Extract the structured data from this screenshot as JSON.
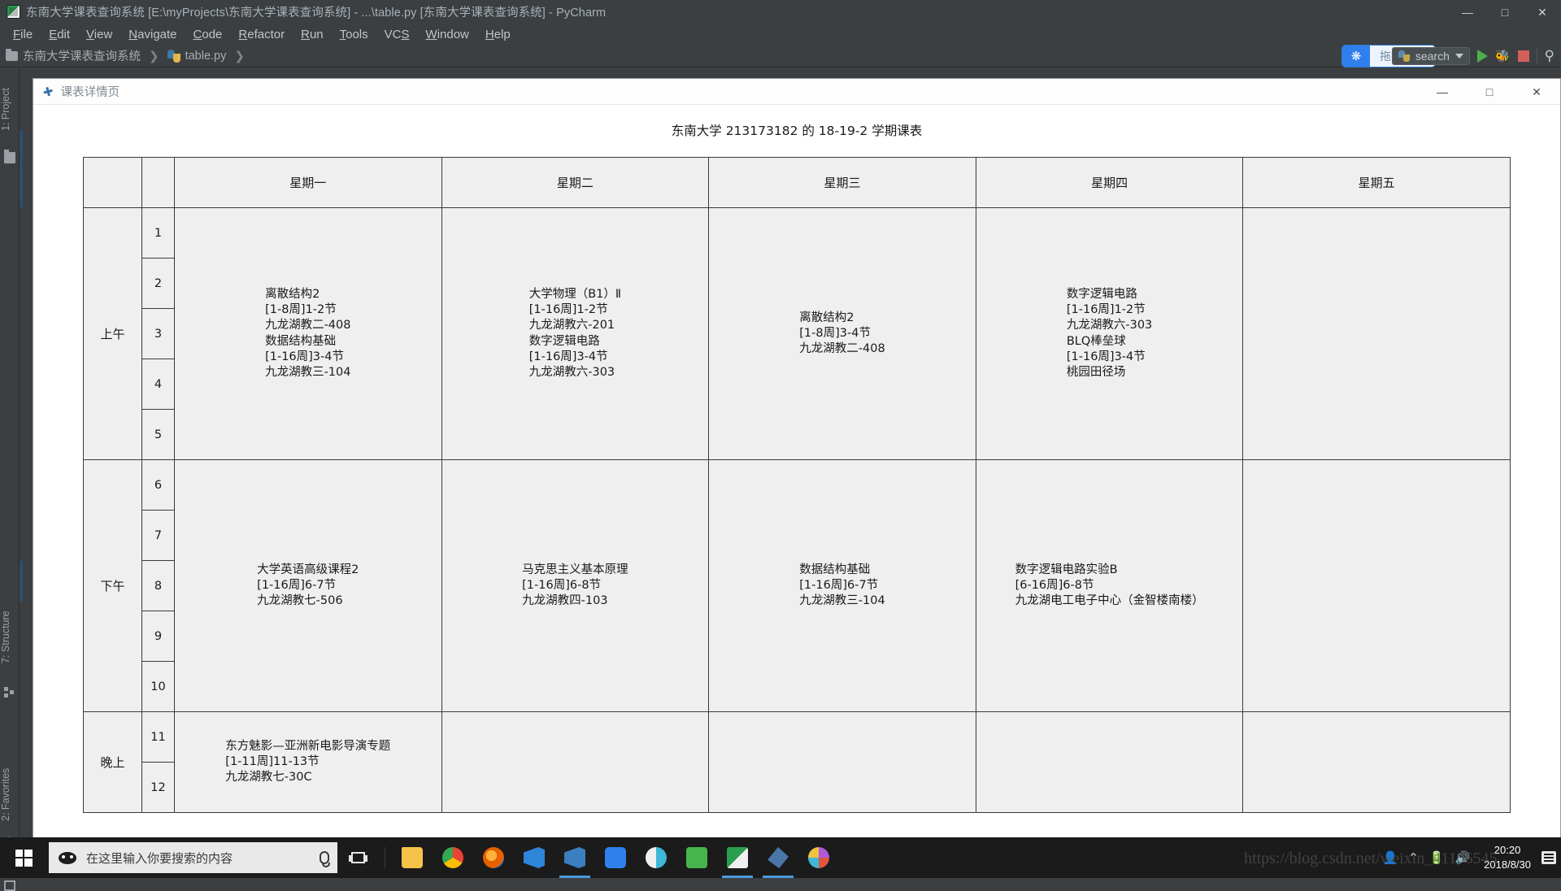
{
  "ide": {
    "window_title": "东南大学课表查询系统 [E:\\myProjects\\东南大学课表查询系统] - ...\\table.py [东南大学课表查询系统] - PyCharm",
    "app_icon": "pycharm-icon",
    "window_controls": {
      "minimize": "—",
      "maximize": "□",
      "close": "✕"
    },
    "menu": [
      {
        "label": "File"
      },
      {
        "label": "Edit"
      },
      {
        "label": "View"
      },
      {
        "label": "Navigate"
      },
      {
        "label": "Code"
      },
      {
        "label": "Refactor"
      },
      {
        "label": "Run"
      },
      {
        "label": "Tools"
      },
      {
        "label": "VCS"
      },
      {
        "label": "Window"
      },
      {
        "label": "Help"
      }
    ],
    "breadcrumb": {
      "project": "东南大学课表查询系统",
      "file": "table.py",
      "separator": "❯"
    },
    "upload_widget": {
      "label": "拖拽上传",
      "icon": "baidu-cloud-icon",
      "accent": "#2f80ed"
    },
    "run_config": {
      "label": "search",
      "icon": "python-file-icon",
      "caret": "▼"
    },
    "toolbar_buttons": [
      {
        "name": "run-button",
        "icon": "play-icon"
      },
      {
        "name": "debug-button",
        "icon": "bug-icon"
      },
      {
        "name": "stop-button",
        "icon": "stop-icon"
      },
      {
        "name": "search-everywhere-button",
        "icon": "search-icon",
        "glyph": "🔍"
      }
    ],
    "tool_strip": [
      {
        "label": "1: Project",
        "icon": "folder-icon"
      },
      {
        "label": "7: Structure",
        "icon": "structure-icon"
      },
      {
        "label": "2: Favorites",
        "icon": "star-icon"
      }
    ]
  },
  "child_window": {
    "title": "课表详情页",
    "icon": "feather-icon",
    "controls": {
      "minimize": "—",
      "maximize": "□",
      "close": "✕"
    }
  },
  "sheet": {
    "title": "东南大学 213173182 的 18-19-2 学期课表",
    "days": [
      "",
      "",
      "星期一",
      "星期二",
      "星期三",
      "星期四",
      "星期五"
    ],
    "segments": [
      {
        "label": "上午",
        "periods": [
          "1",
          "2",
          "3",
          "4",
          "5"
        ]
      },
      {
        "label": "下午",
        "periods": [
          "6",
          "7",
          "8",
          "9",
          "10"
        ]
      },
      {
        "label": "晚上",
        "periods": [
          "11",
          "12"
        ]
      }
    ],
    "cells": {
      "morning": {
        "mon": [
          "离散结构2",
          "[1-8周]1-2节",
          "九龙湖教二-408",
          "数据结构基础",
          "[1-16周]3-4节",
          "九龙湖教三-104"
        ],
        "tue": [
          "大学物理（B1）Ⅱ",
          "[1-16周]1-2节",
          "九龙湖教六-201",
          "数字逻辑电路",
          "[1-16周]3-4节",
          "九龙湖教六-303"
        ],
        "wed": [
          "离散结构2",
          "[1-8周]3-4节",
          "九龙湖教二-408"
        ],
        "thu": [
          "数字逻辑电路",
          "[1-16周]1-2节",
          "九龙湖教六-303",
          "BLQ棒垒球",
          "[1-16周]3-4节",
          "桃园田径场"
        ],
        "fri": []
      },
      "afternoon": {
        "mon": [
          "大学英语高级课程2",
          "[1-16周]6-7节",
          "九龙湖教七-506"
        ],
        "tue": [
          "马克思主义基本原理",
          "[1-16周]6-8节",
          "九龙湖教四-103"
        ],
        "wed": [
          "数据结构基础",
          "[1-16周]6-7节",
          "九龙湖教三-104"
        ],
        "thu": [
          "数字逻辑电路实验B",
          "[6-16周]6-8节",
          "九龙湖电工电子中心（金智楼南楼）"
        ],
        "fri": []
      },
      "evening": {
        "mon": [
          "东方魅影—亚洲新电影导演专题",
          "[1-11周]11-13节",
          "九龙湖教七-30C"
        ],
        "tue": [],
        "wed": [],
        "thu": [],
        "fri": []
      }
    }
  },
  "taskbar": {
    "start_icon": "windows-logo-icon",
    "search_placeholder": "在这里输入你要搜索的内容",
    "search_icon": "cortana-icon",
    "mic_icon": "microphone-icon",
    "task_view_icon": "task-view-icon",
    "apps": [
      {
        "name": "file-explorer",
        "icon": "folder-icon",
        "color": "#f5c34a"
      },
      {
        "name": "google-chrome",
        "icon": "chrome-icon",
        "color": "#4285f4"
      },
      {
        "name": "firefox",
        "icon": "firefox-icon",
        "color": "#e66000"
      },
      {
        "name": "visual-studio-code",
        "icon": "vscode-icon",
        "color": "#2e86d8"
      },
      {
        "name": "visual-studio-code-insiders",
        "icon": "vscode-insiders-icon",
        "color": "#3a7fbf"
      },
      {
        "name": "baidu-netdisk",
        "icon": "baidu-cloud-icon",
        "color": "#2f80ed"
      },
      {
        "name": "thunder",
        "icon": "spiral-icon",
        "color": "#3fb7d6"
      },
      {
        "name": "wechat-dev-tools",
        "icon": "green-app-icon",
        "color": "#46b54d"
      },
      {
        "name": "pycharm",
        "icon": "pycharm-icon",
        "color": "#2a9d4f"
      },
      {
        "name": "feather-app",
        "icon": "feather-icon",
        "color": "#4a77a8"
      },
      {
        "name": "spinner-app",
        "icon": "colorful-icon",
        "color": "#b05ad8"
      }
    ],
    "tray": [
      {
        "name": "people-icon",
        "glyph": "👤"
      },
      {
        "name": "chevron-up-icon",
        "glyph": "⌃"
      },
      {
        "name": "battery-icon",
        "glyph": "🔋"
      },
      {
        "name": "volume-icon",
        "glyph": "🔊"
      }
    ],
    "clock": {
      "time": "20:20",
      "date": "2018/8/30"
    },
    "action_center_icon": "notification-icon"
  },
  "watermark": "https://blog.csdn.net/weixin_41106545"
}
